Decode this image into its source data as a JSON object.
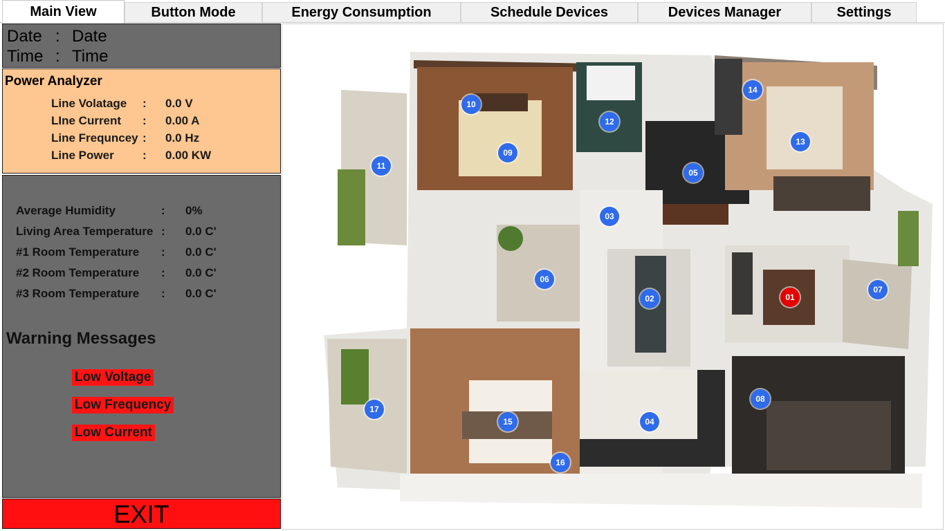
{
  "tabs": [
    {
      "label": "Main View",
      "active": true
    },
    {
      "label": "Button Mode",
      "active": false
    },
    {
      "label": "Energy Consumption",
      "active": false
    },
    {
      "label": "Schedule Devices",
      "active": false
    },
    {
      "label": "Devices Manager",
      "active": false
    },
    {
      "label": "Settings",
      "active": false
    }
  ],
  "datetime": {
    "date_label": "Date",
    "date_sep": ":",
    "date_value": "Date",
    "time_label": "Time",
    "time_sep": ":",
    "time_value": "Time"
  },
  "power": {
    "title": "Power Analyzer",
    "rows": [
      {
        "label": "Line Volatage",
        "sep": ":",
        "value": "0.0 V"
      },
      {
        "label": "LIne Current",
        "sep": ":",
        "value": "0.00 A"
      },
      {
        "label": "Line Frequncey",
        "sep": ":",
        "value": "0.0 Hz"
      },
      {
        "label": "Line Power",
        "sep": ":",
        "value": "0.00 KW"
      }
    ]
  },
  "sensors": {
    "rows": [
      {
        "label": "Average Humidity",
        "sep": ":",
        "value": "0%"
      },
      {
        "label": "Living Area Temperature",
        "sep": ":",
        "value": "0.0 C'"
      },
      {
        "label": "#1 Room Temperature",
        "sep": ":",
        "value": "0.0 C'"
      },
      {
        "label": "#2 Room Temperature",
        "sep": ":",
        "value": "0.0 C'"
      },
      {
        "label": "#3 Room Temperature",
        "sep": ":",
        "value": "0.0 C'"
      }
    ],
    "warning_title": "Warning Messages",
    "warnings": [
      "Low Voltage",
      "Low Frequency",
      "Low Current"
    ],
    "warning_color": "#ff1414"
  },
  "exit_label": "EXIT",
  "markers": [
    {
      "label": "01",
      "status": "active"
    },
    {
      "label": "02",
      "status": "inactive"
    },
    {
      "label": "03",
      "status": "inactive"
    },
    {
      "label": "04",
      "status": "inactive"
    },
    {
      "label": "05",
      "status": "inactive"
    },
    {
      "label": "06",
      "status": "inactive"
    },
    {
      "label": "07",
      "status": "inactive"
    },
    {
      "label": "08",
      "status": "inactive"
    },
    {
      "label": "09",
      "status": "inactive"
    },
    {
      "label": "10",
      "status": "inactive"
    },
    {
      "label": "11",
      "status": "inactive"
    },
    {
      "label": "12",
      "status": "inactive"
    },
    {
      "label": "13",
      "status": "inactive"
    },
    {
      "label": "14",
      "status": "inactive"
    },
    {
      "label": "15",
      "status": "inactive"
    },
    {
      "label": "16",
      "status": "inactive"
    },
    {
      "label": "17",
      "status": "inactive"
    }
  ],
  "colors": {
    "marker_inactive": "#2f6bea",
    "marker_active": "#e50000",
    "panel_gray": "#6b6b6b",
    "power_panel": "#fec690",
    "exit": "#ff0f0f"
  }
}
